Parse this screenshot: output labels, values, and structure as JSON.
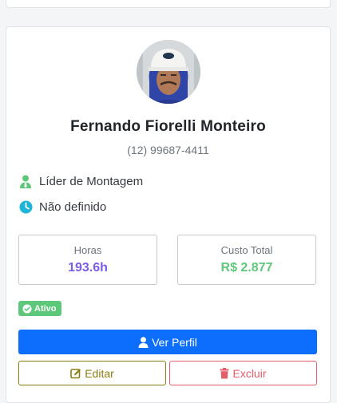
{
  "profile": {
    "name": "Fernando Fiorelli Monteiro",
    "phone": "(12) 99687-4411",
    "role": "Líder de Montagem",
    "shift": "Não definido"
  },
  "stats": {
    "hours_label": "Horas",
    "hours_value": "193.6h",
    "cost_label": "Custo Total",
    "cost_value": "R$ 2.877"
  },
  "status": {
    "label": "Ativo",
    "color": "#5dc87a"
  },
  "actions": {
    "view_profile": "Ver Perfil",
    "edit": "Editar",
    "delete": "Excluir"
  },
  "icons": {
    "role": "user-tie-icon",
    "shift": "clock-icon",
    "status": "check-circle-icon",
    "view_profile": "user-icon",
    "edit": "edit-icon",
    "delete": "trash-icon"
  },
  "colors": {
    "primary": "#0d6efd",
    "hours": "#7b5ce5",
    "cost": "#5dc87a",
    "edit": "#8a7d10",
    "delete": "#e35d6a",
    "role_icon": "#5dc87a",
    "shift_icon": "#1fb5d8"
  }
}
